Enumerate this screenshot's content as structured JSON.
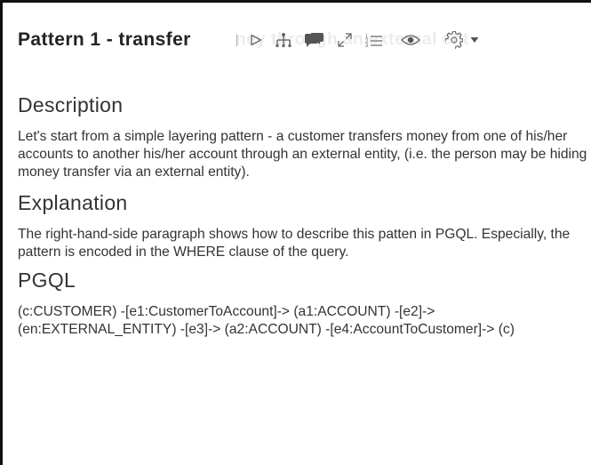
{
  "paragraph": {
    "title": "Pattern 1 - transfer",
    "ghost_text": "ney through an external ent"
  },
  "toolbar": {
    "icons": [
      "run-icon",
      "network-icon",
      "comment-icon",
      "expand-icon",
      "list-icon",
      "eye-icon",
      "gear-icon",
      "caret-down-icon"
    ]
  },
  "sections": {
    "description": {
      "heading": "Description",
      "body": "Let's start from a simple layering pattern - a customer transfers money from one of his/her accounts to another his/her account through an external entity, (i.e. the person may be hiding money transfer via an external entity)."
    },
    "explanation": {
      "heading": "Explanation",
      "body": "The right-hand-side paragraph shows how to describe this patten in PGQL. Especially, the pattern is encoded in the WHERE clause of the query."
    },
    "pgql": {
      "heading": "PGQL",
      "body": "(c:CUSTOMER) -[e1:CustomerToAccount]-> (a1:ACCOUNT) -[e2]-> (en:EXTERNAL_ENTITY) -[e3]-> (a2:ACCOUNT) -[e4:AccountToCustomer]-> (c)"
    }
  }
}
